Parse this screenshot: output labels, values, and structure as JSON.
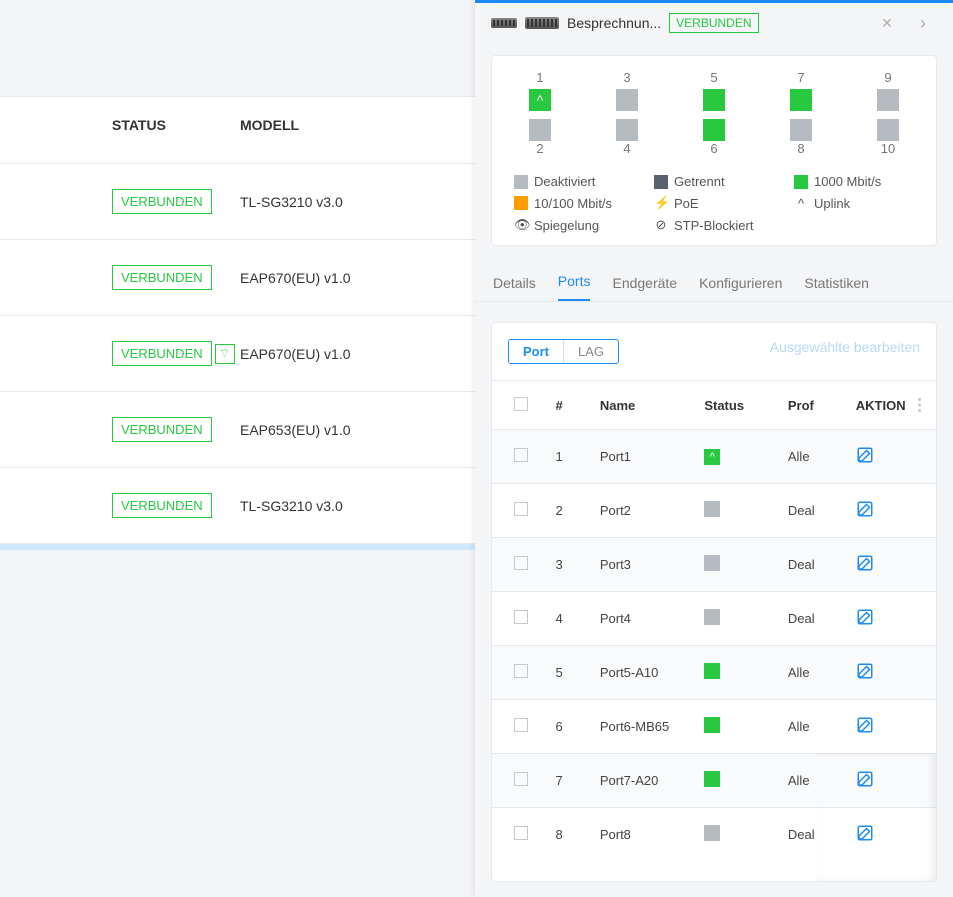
{
  "left": {
    "header": {
      "status": "STATUS",
      "modell": "MODELL"
    },
    "rows": [
      {
        "status": "VERBUNDEN",
        "wifi": false,
        "modell": "TL-SG3210 v3.0"
      },
      {
        "status": "VERBUNDEN",
        "wifi": false,
        "modell": "EAP670(EU) v1.0"
      },
      {
        "status": "VERBUNDEN",
        "wifi": true,
        "modell": "EAP670(EU) v1.0"
      },
      {
        "status": "VERBUNDEN",
        "wifi": false,
        "modell": "EAP653(EU) v1.0"
      },
      {
        "status": "VERBUNDEN",
        "wifi": false,
        "modell": "TL-SG3210 v3.0"
      }
    ]
  },
  "panel": {
    "title": "Besprechnun...",
    "status": "VERBUNDEN",
    "portmap": {
      "top": [
        {
          "n": "1",
          "s": "uplink"
        },
        {
          "n": "3",
          "s": "gray"
        },
        {
          "n": "5",
          "s": "green"
        },
        {
          "n": "7",
          "s": "green"
        },
        {
          "n": "9",
          "s": "gray"
        }
      ],
      "bottom": [
        {
          "n": "2",
          "s": "gray"
        },
        {
          "n": "4",
          "s": "gray"
        },
        {
          "n": "6",
          "s": "green"
        },
        {
          "n": "8",
          "s": "gray"
        },
        {
          "n": "10",
          "s": "gray"
        }
      ]
    },
    "legend": {
      "deactivated": "Deaktiviert",
      "disconnected": "Getrennt",
      "gbit": "1000 Mbit/s",
      "fe": "10/100 Mbit/s",
      "poe": "PoE",
      "uplink": "Uplink",
      "mirror": "Spiegelung",
      "stp": "STP-Blockiert"
    },
    "tabs": {
      "details": "Details",
      "ports": "Ports",
      "clients": "Endgeräte",
      "config": "Konfigurieren",
      "stats": "Statistiken",
      "active": "ports"
    },
    "ports_section": {
      "toggle": {
        "port": "Port",
        "lag": "LAG"
      },
      "edit_selected": "Ausgewählte bearbeiten",
      "columns": {
        "num": "#",
        "name": "Name",
        "status": "Status",
        "profile": "Prof",
        "action": "AKTION"
      },
      "rows": [
        {
          "num": "1",
          "name": "Port1",
          "status": "uplink",
          "profile": "Alle"
        },
        {
          "num": "2",
          "name": "Port2",
          "status": "gray",
          "profile": "Deal"
        },
        {
          "num": "3",
          "name": "Port3",
          "status": "gray",
          "profile": "Deal"
        },
        {
          "num": "4",
          "name": "Port4",
          "status": "gray",
          "profile": "Deal"
        },
        {
          "num": "5",
          "name": "Port5-A10",
          "status": "green",
          "profile": "Alle"
        },
        {
          "num": "6",
          "name": "Port6-MB65",
          "status": "green",
          "profile": "Alle"
        },
        {
          "num": "7",
          "name": "Port7-A20",
          "status": "green",
          "profile": "Alle"
        },
        {
          "num": "8",
          "name": "Port8",
          "status": "gray",
          "profile": "Deal"
        }
      ]
    }
  }
}
